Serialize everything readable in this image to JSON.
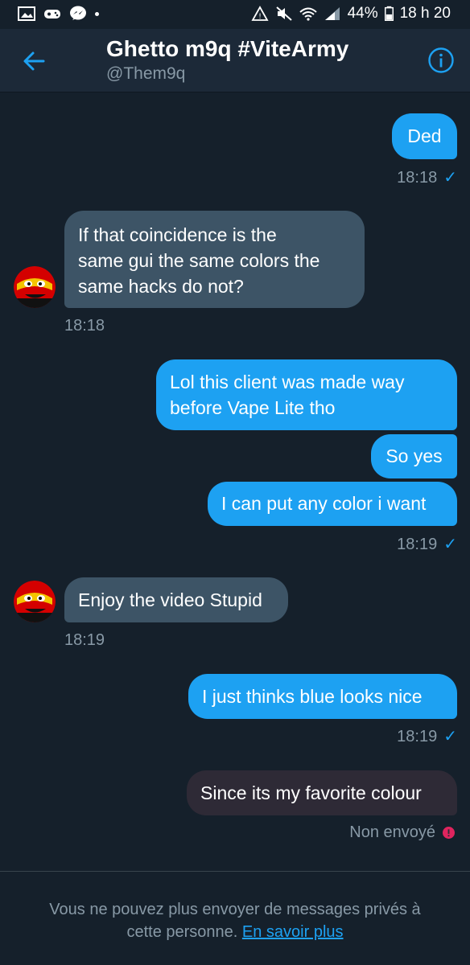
{
  "status_bar": {
    "battery": "44%",
    "time": "18 h 20"
  },
  "header": {
    "title": "Ghetto m9q #ViteArmy",
    "handle": "@Them9q"
  },
  "messages": [
    {
      "direction": "out",
      "text": "Ded",
      "time": "18:18"
    },
    {
      "direction": "in",
      "lines": [
        "If that coincidence is the",
        "same gui the same colors the",
        "same hacks do not?"
      ],
      "time": "18:18"
    },
    {
      "direction": "out",
      "lines": [
        "Lol this client was made way",
        "before Vape Lite tho"
      ]
    },
    {
      "direction": "out",
      "text": "So yes"
    },
    {
      "direction": "out",
      "text": "I can put any color i want",
      "time": "18:19"
    },
    {
      "direction": "in",
      "text": "Enjoy the video Stupid",
      "time": "18:19"
    },
    {
      "direction": "out",
      "text": "I just thinks blue looks nice",
      "time": "18:19"
    },
    {
      "direction": "out",
      "text": "Since its my favorite colour",
      "status": "Non envoyé"
    }
  ],
  "footer": {
    "line1": "Vous ne pouvez plus envoyer de messages privés à",
    "line2_prefix": "cette personne.",
    "link": "En savoir plus"
  },
  "colors": {
    "background": "#15202b",
    "header": "#1c2938",
    "accent": "#1da1f2",
    "incoming_bubble": "#3d5466",
    "failed_bubble": "#2e2a36",
    "error": "#e0245e"
  }
}
